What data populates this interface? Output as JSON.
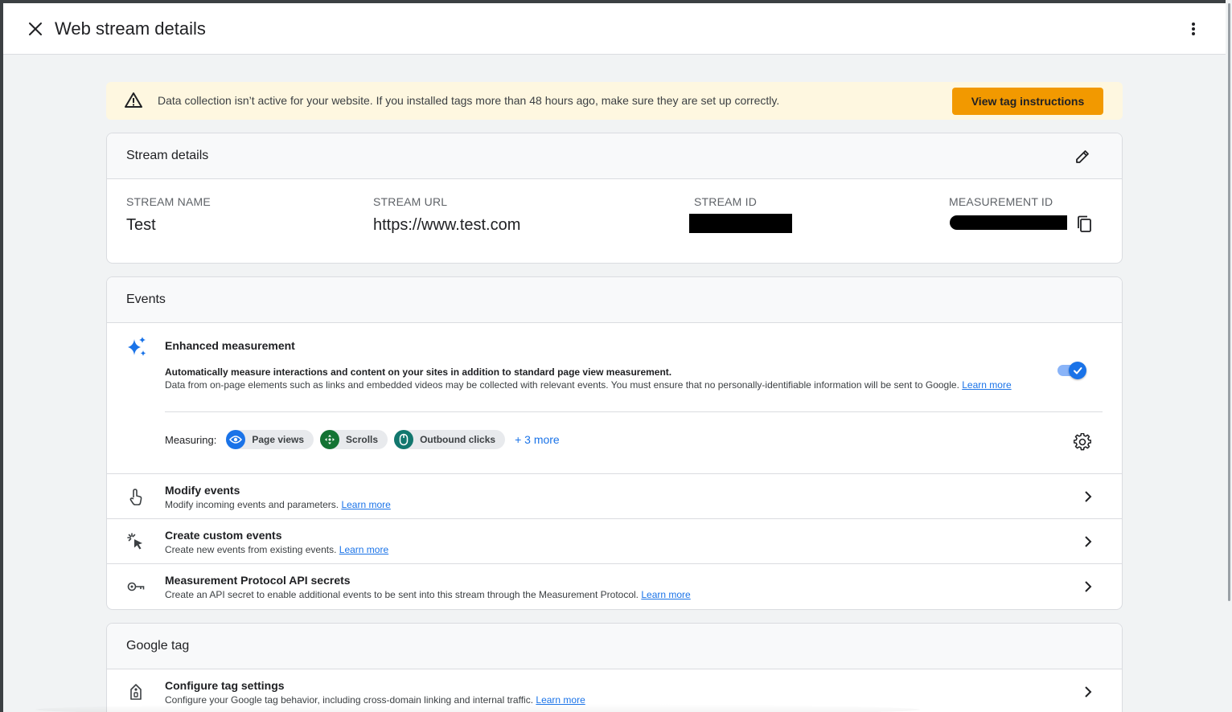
{
  "header": {
    "title": "Web stream details"
  },
  "banner": {
    "message": "Data collection isn’t active for your website. If you installed tags more than 48 hours ago, make sure they are set up correctly.",
    "button_label": "View tag instructions"
  },
  "stream_details": {
    "title": "Stream details",
    "fields": [
      {
        "label": "STREAM NAME",
        "value": "Test"
      },
      {
        "label": "STREAM URL",
        "value": "https://www.test.com"
      },
      {
        "label": "STREAM ID",
        "value": ""
      },
      {
        "label": "MEASUREMENT ID",
        "value": ""
      }
    ]
  },
  "events": {
    "title": "Events",
    "enhanced": {
      "title": "Enhanced measurement",
      "desc1": "Automatically measure interactions and content on your sites in addition to standard page view measurement.",
      "desc2": "Data from on-page elements such as links and embedded videos may be collected with relevant events. You must ensure that no personally-identifiable information will be sent to Google.",
      "learn_more": "Learn more",
      "toggle_on": true,
      "measuring_label": "Measuring:",
      "chips": [
        {
          "label": "Page views",
          "icon": "eye-icon",
          "color": "#1a73e8"
        },
        {
          "label": "Scrolls",
          "icon": "move-icon",
          "color": "#137333"
        },
        {
          "label": "Outbound clicks",
          "icon": "mouse-icon",
          "color": "#12776e"
        }
      ],
      "more_label": "+ 3 more"
    },
    "rows": [
      {
        "title": "Modify events",
        "subtitle": "Modify incoming events and parameters.",
        "link": "Learn more",
        "icon": "touch-icon"
      },
      {
        "title": "Create custom events",
        "subtitle": "Create new events from existing events.",
        "link": "Learn more",
        "icon": "sparkle-cursor-icon"
      },
      {
        "title": "Measurement Protocol API secrets",
        "subtitle": "Create an API secret to enable additional events to be sent into this stream through the Measurement Protocol.",
        "link": "Learn more",
        "icon": "key-icon"
      }
    ]
  },
  "google_tag": {
    "title": "Google tag",
    "rows": [
      {
        "title": "Configure tag settings",
        "subtitle": "Configure your Google tag behavior, including cross-domain linking and internal traffic.",
        "link": "Learn more",
        "icon": "tag-icon"
      }
    ]
  },
  "colors": {
    "accent": "#1a73e8",
    "banner_bg": "#fef7e0",
    "banner_button": "#f29900"
  }
}
